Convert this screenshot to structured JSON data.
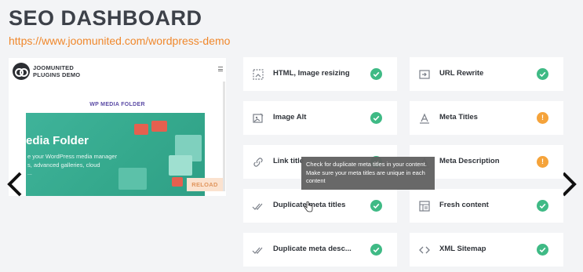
{
  "header": {
    "title": "SEO DASHBOARD",
    "url": "https://www.joomunited.com/wordpress-demo"
  },
  "preview": {
    "brand_line1": "JOOMUNITED",
    "brand_line2": "PLUGINS DEMO",
    "media_title": "WP MEDIA FOLDER",
    "hero_title": "edia Folder",
    "hero_sub_line1": "e your WordPress media manager",
    "hero_sub_line2": "s, advanced galleries, cloud",
    "hero_dots": "...",
    "reload_label": "RELOAD"
  },
  "cards": [
    {
      "id": "html-image-resizing",
      "label": "HTML, Image resizing",
      "icon": "image-resize-icon",
      "status": "ok"
    },
    {
      "id": "url-rewrite",
      "label": "URL Rewrite",
      "icon": "url-rewrite-icon",
      "status": "ok"
    },
    {
      "id": "image-alt",
      "label": "Image Alt",
      "icon": "image-alt-icon",
      "status": "ok"
    },
    {
      "id": "meta-titles",
      "label": "Meta Titles",
      "icon": "text-icon",
      "status": "warn",
      "status_text": "!"
    },
    {
      "id": "link-titles",
      "label": "Link title",
      "icon": "link-icon",
      "status": "ok"
    },
    {
      "id": "meta-description",
      "label": "Meta Description",
      "icon": "text-icon",
      "status": "warn",
      "status_text": "!"
    },
    {
      "id": "duplicate-meta-titles",
      "label": "Duplicate meta titles",
      "icon": "double-check-icon",
      "status": "ok"
    },
    {
      "id": "fresh-content",
      "label": "Fresh content",
      "icon": "layout-icon",
      "status": "ok"
    },
    {
      "id": "duplicate-meta-desc",
      "label": "Duplicate meta desc...",
      "icon": "double-check-icon",
      "status": "ok"
    },
    {
      "id": "xml-sitemap",
      "label": "XML Sitemap",
      "icon": "code-icon",
      "status": "ok"
    }
  ],
  "tooltip": {
    "text": "Check for duplicate meta titles in your content. Make sure your meta titles are unique in each content"
  },
  "colors": {
    "accent": "#f0882c",
    "ok": "#3fba85",
    "warn": "#f5a33a"
  }
}
